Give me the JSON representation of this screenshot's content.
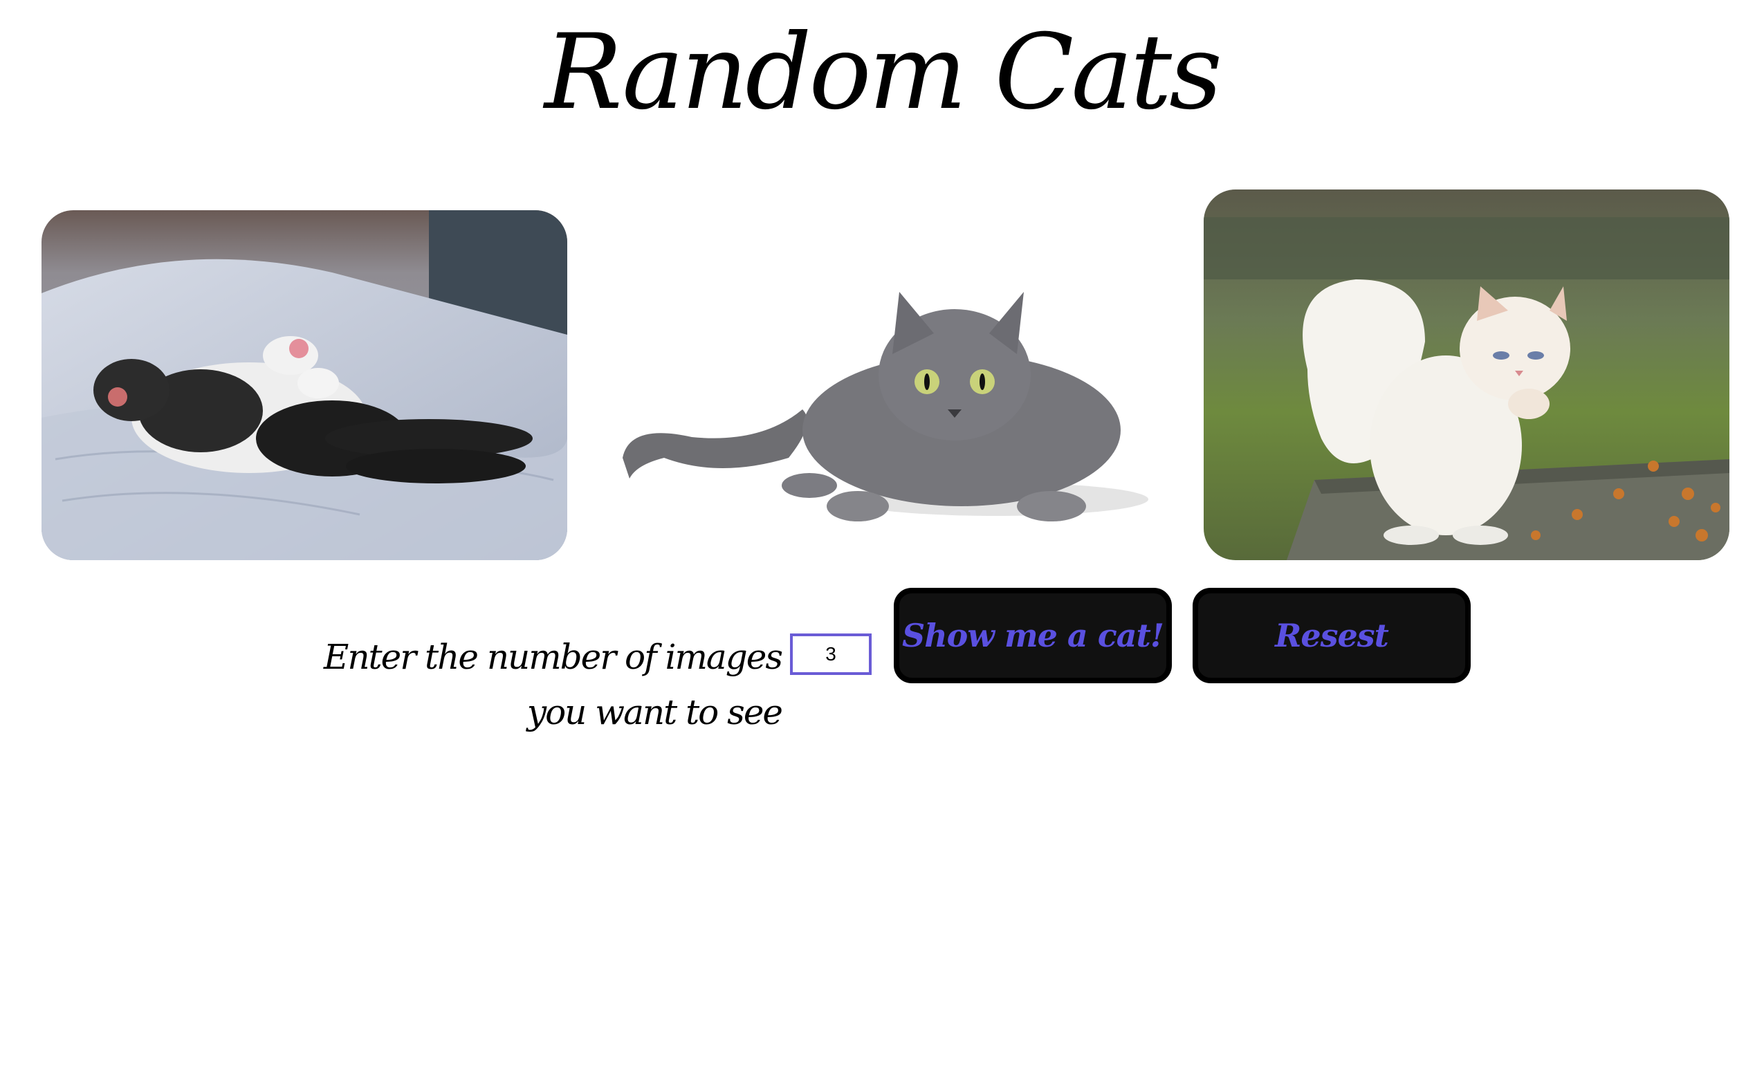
{
  "page": {
    "title": "Random Cats"
  },
  "gallery": {
    "images": [
      {
        "alt": "cat-sleeping-on-bed"
      },
      {
        "alt": "grey-cat-crouching"
      },
      {
        "alt": "white-squirrel-cat"
      }
    ]
  },
  "controls": {
    "label": "Enter the number of images you want to see",
    "count_value": "3",
    "show_button_label": "Show me a cat!",
    "reset_button_label": "Resest"
  },
  "colors": {
    "accent": "#5a50e0",
    "button_bg": "#111111",
    "input_border": "#6a5cd6"
  }
}
